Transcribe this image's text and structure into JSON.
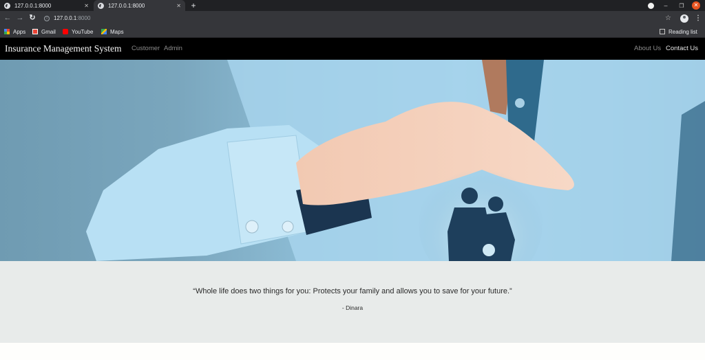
{
  "browser": {
    "tabs": [
      {
        "title": "127.0.0.1:8000",
        "active": false
      },
      {
        "title": "127.0.0.1:8000",
        "active": true
      }
    ],
    "address": {
      "host": "127.0.0.1",
      "port": ":8000"
    },
    "bookmarks": [
      {
        "label": "Apps",
        "icon": "apps-grid-icon"
      },
      {
        "label": "Gmail",
        "icon": "gmail-icon"
      },
      {
        "label": "YouTube",
        "icon": "youtube-icon"
      },
      {
        "label": "Maps",
        "icon": "maps-icon"
      }
    ],
    "reading_list": "Reading list",
    "colors": {
      "close_button": "#e95420",
      "tab_active": "#35363a",
      "tab_bar": "#202124"
    }
  },
  "site": {
    "brand": "Insurance Management System",
    "nav_left": [
      "Customer",
      "Admin"
    ],
    "nav_right": [
      "About Us",
      "Contact Us"
    ],
    "hero_image": "hand-protecting-family-silhouette",
    "quote": "“Whole life does two things for you: Protects your family and allows you to save for your future.”",
    "author": "- Dinara",
    "colors": {
      "navbar": "#000000",
      "quote_bg": "#e8ebea",
      "hero_blue": "#8ebed7"
    }
  }
}
